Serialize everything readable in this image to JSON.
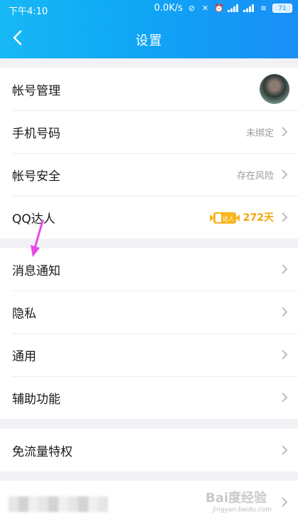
{
  "status_bar": {
    "time": "下午4:10",
    "network_speed": "0.0K/s",
    "battery": "71"
  },
  "header": {
    "title": "设置",
    "back_icon": "chevron-left-icon"
  },
  "groups": [
    {
      "rows": [
        {
          "label": "帐号管理",
          "trailing": "avatar"
        },
        {
          "label": "手机号码",
          "value": "未绑定"
        },
        {
          "label": "帐号安全",
          "value": "存在风险"
        },
        {
          "label": "QQ达人",
          "badge": "达人",
          "value": "272天"
        }
      ]
    },
    {
      "rows": [
        {
          "label": "消息通知"
        },
        {
          "label": "隐私"
        },
        {
          "label": "通用"
        },
        {
          "label": "辅助功能"
        }
      ]
    },
    {
      "rows": [
        {
          "label": "免流量特权"
        }
      ]
    }
  ],
  "watermark": {
    "logo": "Bai度经验",
    "url": "jingyan.baidu.com"
  },
  "colors": {
    "header_start": "#18b8f5",
    "header_end": "#1a8ff7",
    "qq_days": "#f4a50b",
    "annotation_arrow": "#e64be6"
  }
}
